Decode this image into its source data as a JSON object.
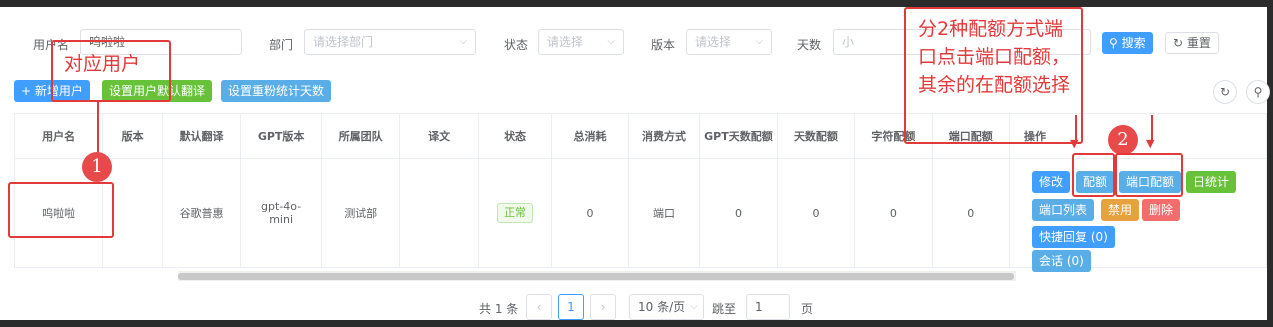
{
  "filters": {
    "username_label": "用户名",
    "username_value": "呜啦啦",
    "dept_label": "部门",
    "dept_placeholder": "请选择部门",
    "status_label": "状态",
    "status_placeholder": "请选择",
    "version_label": "版本",
    "version_placeholder": "请选择",
    "days_label": "天数",
    "days_placeholder": "小",
    "search_btn": "搜索",
    "reset_btn": "重置"
  },
  "toolbar": {
    "add_user": "+ 新增用户",
    "set_default_translate": "设置用户默认翻译",
    "set_reset_days": "设置重粉统计天数"
  },
  "table": {
    "headers": [
      "用户名",
      "版本",
      "默认翻译",
      "GPT版本",
      "所属团队",
      "译文",
      "状态",
      "总消耗",
      "消费方式",
      "GPT天数配额",
      "天数配额",
      "字符配额",
      "端口配额",
      "操作"
    ],
    "row": {
      "username": "呜啦啦",
      "version": "",
      "default_translate": "谷歌普惠",
      "gpt_version": "gpt-4o-mini",
      "team": "测试部",
      "translation": "",
      "status": "正常",
      "total_cost": "0",
      "pay_mode": "端口",
      "gpt_days_quota": "0",
      "days_quota": "0",
      "char_quota": "0",
      "port_quota": "0"
    },
    "actions": {
      "edit": "修改",
      "quota": "配额",
      "port_quota": "端口配额",
      "daily_stats": "日统计",
      "port_list": "端口列表",
      "disable": "禁用",
      "delete": "删除",
      "quick_reply": "快捷回复 (0)",
      "session": "会话 (0)"
    }
  },
  "pagination": {
    "total": "共 1 条",
    "current_page": "1",
    "page_size": "10 条/页",
    "goto_label": "跳至",
    "goto_value": "1",
    "page_suffix": "页"
  },
  "annotations": {
    "user_note": "对应用户",
    "marker_1": "1",
    "marker_2": "2",
    "quota_note": "分2种配额方式端口点击端口配额，其余的在配额选择"
  },
  "colors": {
    "primary": "#409eff",
    "success": "#67c23a",
    "warning": "#e6a23c",
    "danger": "#f56c6c",
    "annotation": "#e23a3a"
  }
}
